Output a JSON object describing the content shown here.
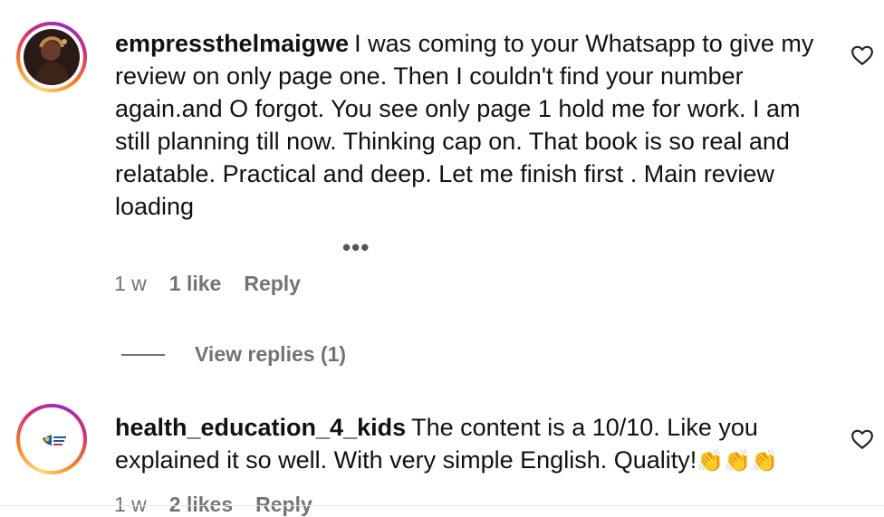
{
  "comments": [
    {
      "username": "empressthelmaigwe",
      "text": "I was coming to your Whatsapp to give my review on only page one. Then I couldn't find your number again.and O forgot. You see only page 1 hold me for work. I am still planning till now. Thinking cap on. That book is so real and relatable. Practical and deep. Let me finish first . Main review loading",
      "more_label": "•••",
      "time": "1 w",
      "likes": "1 like",
      "reply_label": "Reply",
      "view_replies_label": "View replies (1)"
    },
    {
      "username": "health_education_4_kids",
      "text": "The content is a 10/10. Like you explained it so well. With very simple English. Quality!",
      "emoji": "👏👏👏",
      "time": "1 w",
      "likes": "2 likes",
      "reply_label": "Reply"
    }
  ],
  "colors": {
    "text": "#111111",
    "meta": "#737373",
    "ring_start": "#feda75",
    "ring_mid": "#d62976",
    "ring_end": "#962fbf"
  },
  "icons": {
    "like": "heart-outline-icon"
  }
}
